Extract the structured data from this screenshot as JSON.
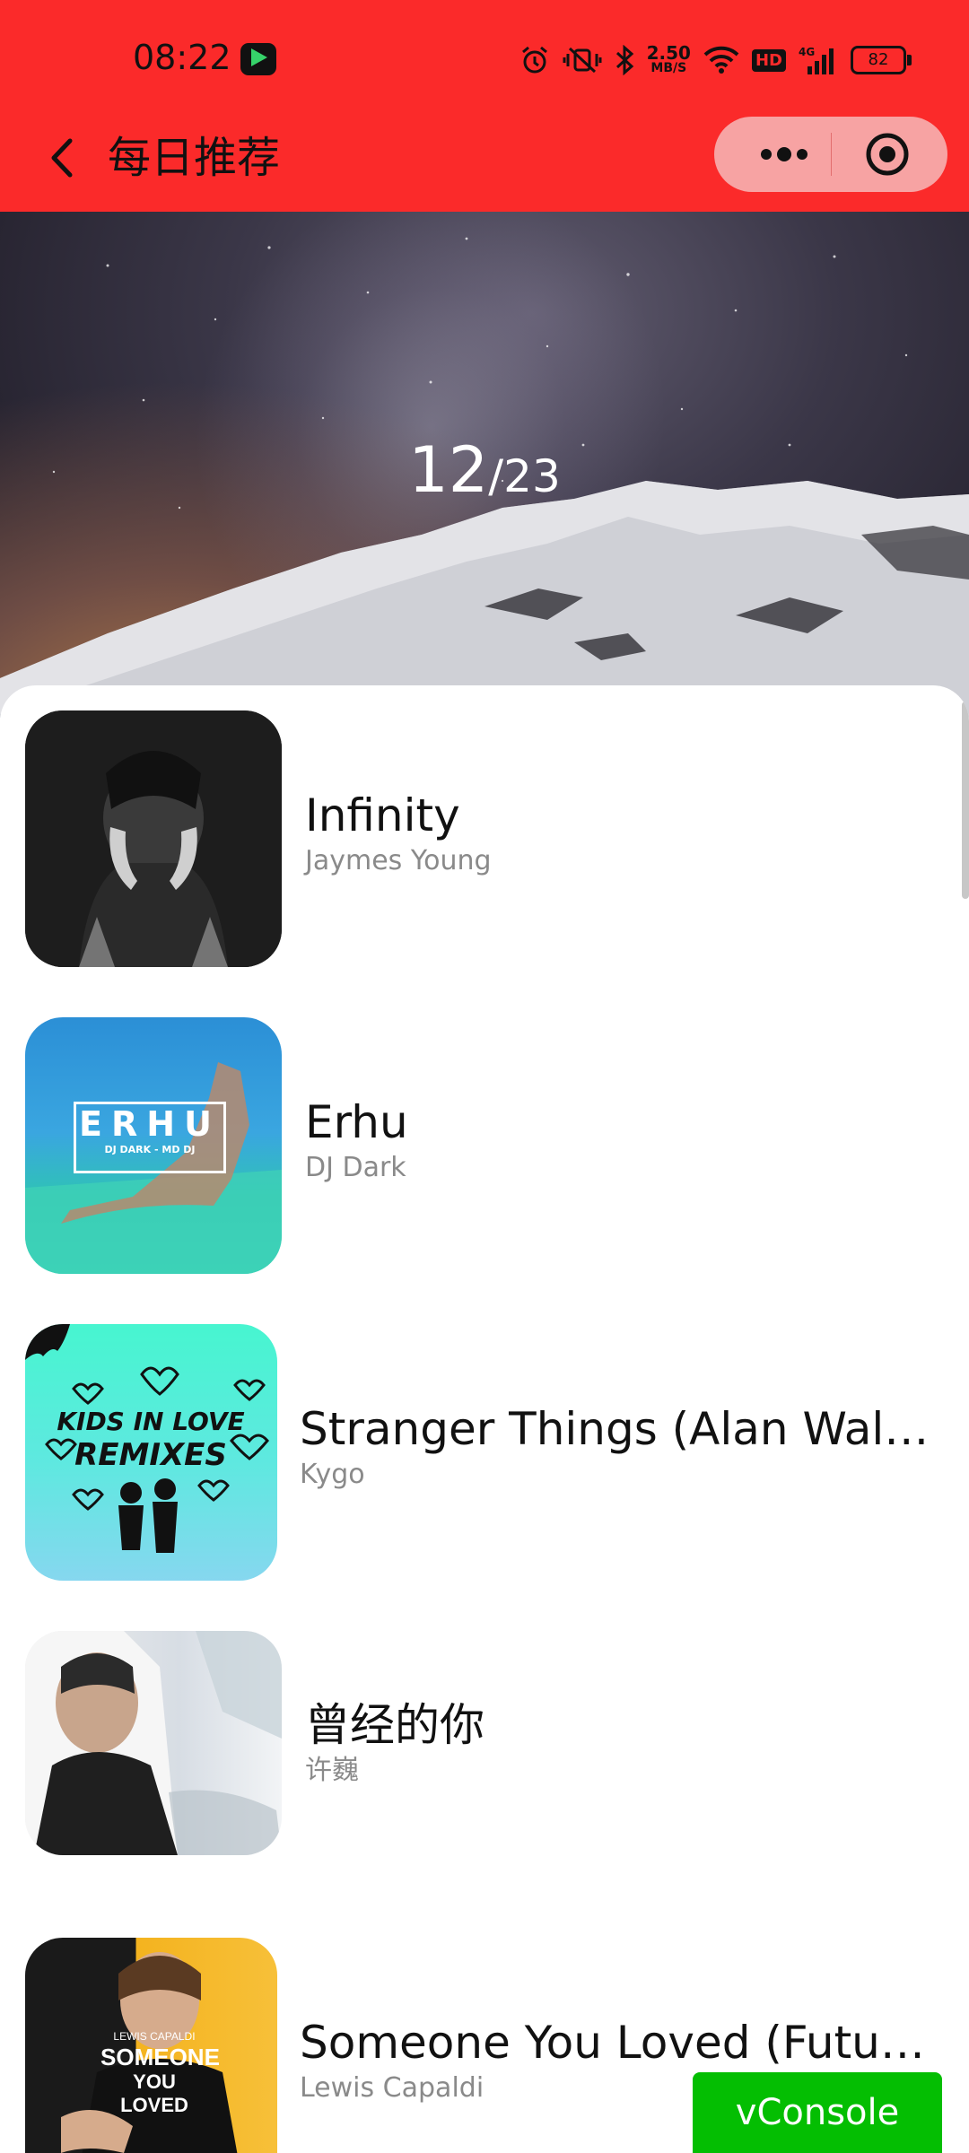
{
  "status_bar": {
    "time": "08:22",
    "network_speed_value": "2.50",
    "network_speed_unit": "MB/S",
    "hd_label": "HD",
    "signal_label": "4G",
    "battery": "82"
  },
  "header": {
    "title": "每日推荐"
  },
  "hero": {
    "day": "12",
    "month": "/23"
  },
  "songs": [
    {
      "name": "Infinity",
      "artist": "Jaymes Young"
    },
    {
      "name": "Erhu",
      "artist": "DJ Dark",
      "cover_text": "ERHU",
      "cover_subtext": "DJ DARK - MD DJ"
    },
    {
      "name": "Stranger Things (Alan Walker Remix)",
      "artist": "Kygo",
      "cover_text_1": "KIDS IN LOVE",
      "cover_text_2": "REMIXES"
    },
    {
      "name": "曾经的你",
      "artist": "许巍"
    },
    {
      "name": "Someone You Loved (Future Humans Remix)",
      "artist": "Lewis Capaldi",
      "cover_text_1": "LEWIS CAPALDI",
      "cover_text_2": "SOMEONE",
      "cover_text_3": "YOU LOVED"
    }
  ],
  "vconsole": {
    "label": "vConsole"
  },
  "colors": {
    "header_red": "#fb2a2a",
    "vconsole_green": "#04be02"
  }
}
